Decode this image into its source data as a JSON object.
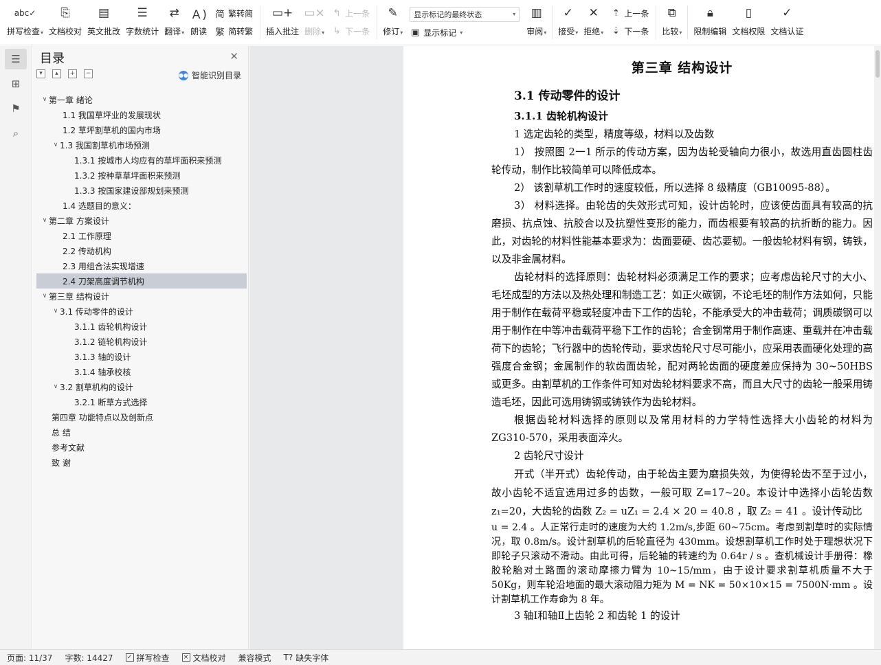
{
  "ribbon": {
    "spell_check": "拼写检查",
    "doc_proof": "文档校对",
    "english_review": "英文批改",
    "word_count": "字数统计",
    "translate": "翻译",
    "read_aloud": "朗读",
    "to_simplified": "繁转简",
    "to_traditional": "简转繁",
    "insert_comment": "插入批注",
    "delete": "删除",
    "prev_comment": "上一条",
    "next_comment": "下一条",
    "revise": "修订",
    "status_select_value": "显示标记的最终状态",
    "show_markup": "显示标记",
    "review": "审阅",
    "accept": "接受",
    "reject": "拒绝",
    "prev_change": "上一条",
    "next_change": "下一条",
    "compare": "比较",
    "restrict_edit": "限制编辑",
    "doc_rights": "文档权限",
    "doc_cert": "文档认证"
  },
  "toc": {
    "title": "目录",
    "smart_label": "智能识别目录",
    "items": [
      {
        "text": "第一章    绪论",
        "level": 1,
        "arrow": "down"
      },
      {
        "text": "1.1    我国草坪业的发展现状",
        "level": 2
      },
      {
        "text": "1.2    草坪割草机的国内市场",
        "level": 2
      },
      {
        "text": "1.3    我国割草机市场预测",
        "level": 2,
        "arrow": "down"
      },
      {
        "text": "1.3.1    按城市人均应有的草坪面积来预测",
        "level": 3
      },
      {
        "text": "1.3.2    按种草草坪面积来预测",
        "level": 3
      },
      {
        "text": "1.3.3    按国家建设部规划来预测",
        "level": 3
      },
      {
        "text": "1.4    选题目的意义：",
        "level": 2
      },
      {
        "text": "第二章    方案设计",
        "level": 1,
        "arrow": "down"
      },
      {
        "text": "2.1  工作原理",
        "level": 2
      },
      {
        "text": "2.2  传动机构",
        "level": 2
      },
      {
        "text": "2.3  用组合法实现增速",
        "level": 2
      },
      {
        "text": "2.4 刀架高度调节机构",
        "level": 2,
        "selected": true
      },
      {
        "text": "第三章    结构设计",
        "level": 1,
        "arrow": "down"
      },
      {
        "text": "3.1    传动零件的设计",
        "level": 2,
        "arrow": "down"
      },
      {
        "text": "3.1.1    齿轮机构设计",
        "level": 3
      },
      {
        "text": "3.1.2    链轮机构设计",
        "level": 3
      },
      {
        "text": "3.1.3    轴的设计",
        "level": 3
      },
      {
        "text": "3.1.4    轴承校核",
        "level": 3
      },
      {
        "text": "3.2    割草机构的设计",
        "level": 2,
        "arrow": "down"
      },
      {
        "text": "3.2.1    断草方式选择",
        "level": 3
      },
      {
        "text": "第四章  功能特点以及创新点",
        "level": 1
      },
      {
        "text": "总      结",
        "level": 1
      },
      {
        "text": "参考文献",
        "level": 1
      },
      {
        "text": "致      谢",
        "level": 1
      }
    ]
  },
  "doc": {
    "chapter_title": "第三章    结构设计",
    "h2": "3.1    传动零件的设计",
    "h3": "3.1.1    齿轮机构设计",
    "p1": "1    选定齿轮的类型，精度等级，材料以及齿数",
    "p2": "1）  按照图 2一1 所示的传动方案，因为齿轮受轴向力很小，故选用直齿圆柱齿轮传动，制作比较简单可以降低成本。",
    "p3": "2）  该割草机工作时的速度较低，所以选择 8 级精度（GB10095-88）。",
    "p4": "3）  材料选择。由轮齿的失效形式可知，设计齿轮时，应该使齿面具有较高的抗磨损、抗点蚀、抗胶合以及抗塑性变形的能力，而齿根要有较高的抗折断的能力。因此，对齿轮的材料性能基本要求为：齿面要硬、齿芯要韧。一般齿轮材料有钢，铸铁，以及非金属材料。",
    "p5": "齿轮材料的选择原则：齿轮材料必须满足工作的要求；应考虑齿轮尺寸的大小、毛坯成型的方法以及热处理和制造工艺：如正火碳钢，不论毛坯的制作方法如何，只能用于制作在载荷平稳或轻度冲击下工作的齿轮，不能承受大的冲击载荷；调质碳钢可以用于制作在中等冲击载荷平稳下工作的齿轮；合金钢常用于制作高速、重载并在冲击载荷下的齿轮；飞行器中的齿轮传动，要求齿轮尺寸尽可能小，应采用表面硬化处理的高强度合金钢；金属制作的软齿面齿轮，配对两轮齿面的硬度差应保持为 30~50HBS 或更多。由割草机的工作条件可知对齿轮材料要求不高，而且大尺寸的齿轮一般采用铸造毛坯，因此可选用铸钢或铸铁作为齿轮材料。",
    "p6": "根据齿轮材料选择的原则以及常用材料的力学特性选择大小齿轮的材料为 ZG310-570，采用表面淬火。",
    "p7": "2    齿轮尺寸设计",
    "p8": "开式（半开式）齿轮传动，由于轮齿主要为磨损失效，为使得轮齿不至于过小，故小齿轮不适宜选用过多的齿数，一般可取 Z=17~20。本设计中选择小齿轮齿数 z₁=20，大齿轮的齿数 Z₂ = uZ₁ = 2.4 × 20 = 40.8 ，取 Z₂ = 41 。设计传动比",
    "p9": "u = 2.4 。人正常行走时的速度为大约 1.2m/s,步距 60~75cm。考虑到割草时的实际情况，取 0.8m/s。设计割草机的后轮直径为 430mm。设想割草机工作时处于理想状况下即轮子只滚动不滑动。由此可得，后轮轴的转速约为 0.64r / s 。查机械设计手册得：橡胶轮胎对土路面的滚动摩擦力臂为 10~15/mm，由于设计要求割草机质量不大于 50Kg，则车轮沿地面的最大滚动阻力矩为 M = NK = 50×10×15 = 7500N·mm 。设计割草机工作寿命为 8 年。",
    "p10": "3    轴Ⅰ和轴Ⅱ上齿轮 2 和齿轮 1 的设计"
  },
  "status": {
    "page": "页面: 11/37",
    "words": "字数: 14427",
    "spell": "拼写检查",
    "proof": "文档校对",
    "compat": "兼容模式",
    "missing_font": "缺失字体"
  }
}
